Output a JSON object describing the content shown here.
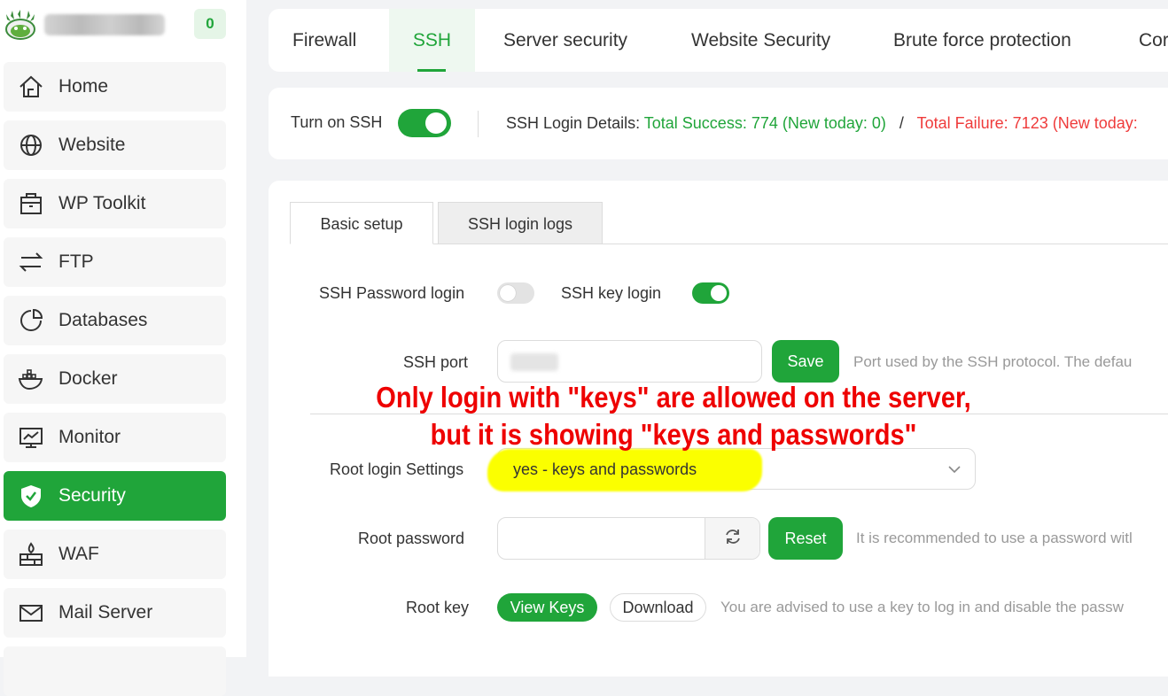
{
  "brand": {
    "badge": "0"
  },
  "sidebar": {
    "items": [
      {
        "label": "Home",
        "icon": "home-icon"
      },
      {
        "label": "Website",
        "icon": "globe-icon"
      },
      {
        "label": "WP Toolkit",
        "icon": "toolkit-icon"
      },
      {
        "label": "FTP",
        "icon": "transfer-icon"
      },
      {
        "label": "Databases",
        "icon": "database-icon"
      },
      {
        "label": "Docker",
        "icon": "docker-icon"
      },
      {
        "label": "Monitor",
        "icon": "monitor-icon"
      },
      {
        "label": "Security",
        "icon": "shield-icon",
        "active": true
      },
      {
        "label": "WAF",
        "icon": "firewall-icon"
      },
      {
        "label": "Mail Server",
        "icon": "mail-icon"
      }
    ]
  },
  "tabs": [
    "Firewall",
    "SSH",
    "Server security",
    "Website Security",
    "Brute force protection",
    "Cor"
  ],
  "active_tab": "SSH",
  "ssh_status": {
    "toggle_label": "Turn on SSH",
    "ssh_enabled": true,
    "details_label": "SSH Login Details:",
    "success_text": "Total Success: 774 (New today: 0)",
    "separator": "/",
    "failure_text": "Total Failure: 7123 (New today:"
  },
  "sub_tabs": [
    "Basic setup",
    "SSH login logs"
  ],
  "active_sub_tab": "Basic setup",
  "settings": {
    "password_login_label": "SSH Password login",
    "password_login_enabled": false,
    "key_login_label": "SSH key login",
    "key_login_enabled": true,
    "port_label": "SSH port",
    "port_value": "",
    "save_label": "Save",
    "port_hint": "Port used by the SSH protocol. The defau",
    "root_login_label": "Root login Settings",
    "root_login_value": "yes - keys and passwords",
    "root_password_label": "Root password",
    "root_password_value": "",
    "reset_label": "Reset",
    "root_password_hint": "It is recommended to use a password witl",
    "root_key_label": "Root key",
    "view_keys_label": "View Keys",
    "download_label": "Download",
    "root_key_hint": "You are advised to use a key to log in and disable the passw"
  },
  "annotation": {
    "line1": "Only login with \"keys\" are allowed on the server,",
    "line2": "but it is showing \"keys and passwords\""
  },
  "colors": {
    "accent": "#20a53a",
    "failure": "#ef3b3b",
    "highlight": "#fbff00",
    "annotation": "#ee0000"
  }
}
